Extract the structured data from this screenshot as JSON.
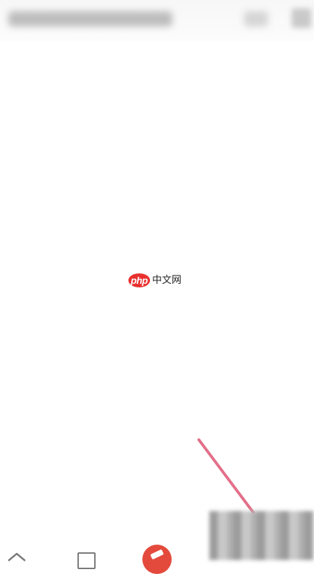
{
  "top_bar": {
    "title_text": "",
    "icons": [
      "menu-icon",
      "more-icon"
    ]
  },
  "watermark": {
    "logo_text": "php",
    "site_text": "中文网"
  },
  "bottom_nav": {
    "icons": [
      "home-icon",
      "box-icon",
      "action-button-icon"
    ]
  },
  "colors": {
    "accent": "#e8312f",
    "pointer_line": "#e27089",
    "background": "#ffffff"
  }
}
